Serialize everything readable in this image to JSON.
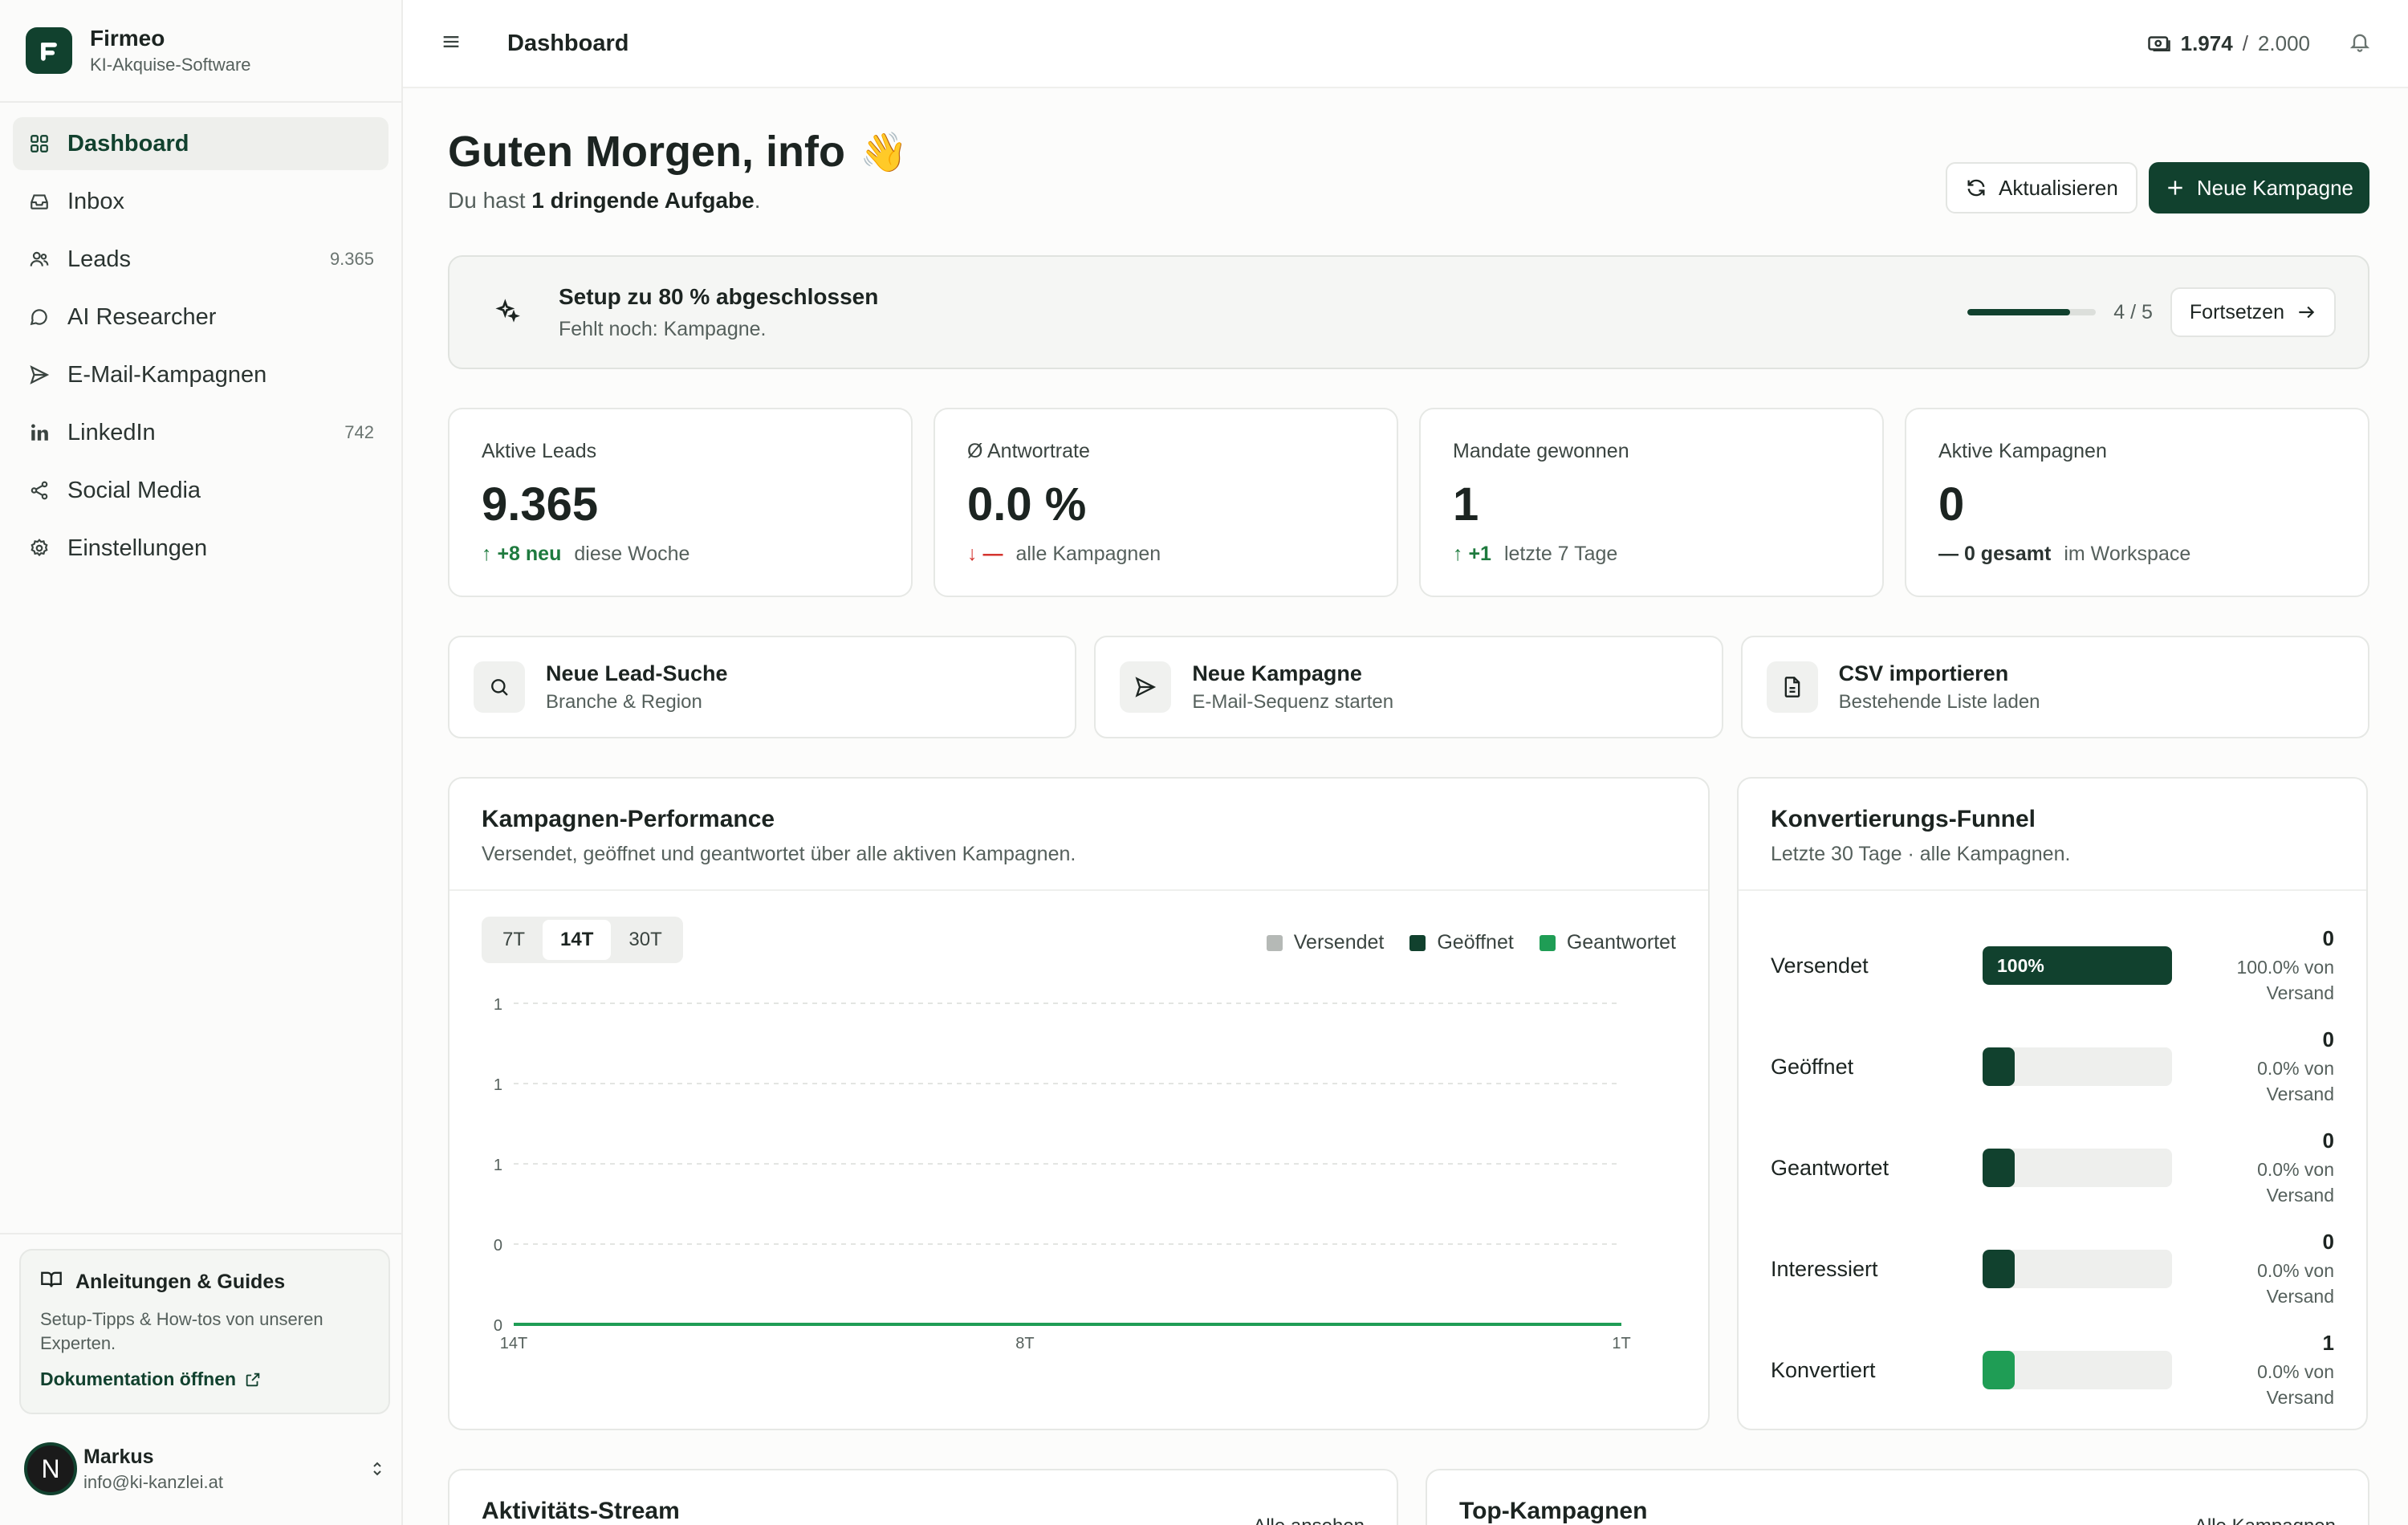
{
  "brand": {
    "name": "Firmeo",
    "subtitle": "KI-Akquise-Software"
  },
  "sidebar": {
    "items": [
      {
        "label": "Dashboard",
        "icon": "grid-icon",
        "count": ""
      },
      {
        "label": "Inbox",
        "icon": "inbox-icon",
        "count": ""
      },
      {
        "label": "Leads",
        "icon": "users-icon",
        "count": "9.365"
      },
      {
        "label": "AI Researcher",
        "icon": "chat-bubble-icon",
        "count": ""
      },
      {
        "label": "E-Mail-Kampagnen",
        "icon": "send-icon",
        "count": ""
      },
      {
        "label": "LinkedIn",
        "icon": "linkedin-icon",
        "count": "742"
      },
      {
        "label": "Social Media",
        "icon": "share-icon",
        "count": ""
      },
      {
        "label": "Einstellungen",
        "icon": "gear-icon",
        "count": ""
      }
    ],
    "guide": {
      "title": "Anleitungen & Guides",
      "description": "Setup-Tipps & How-tos von unseren Experten.",
      "link": "Dokumentation öffnen"
    },
    "user": {
      "initial": "N",
      "name": "Markus",
      "email": "info@ki-kanzlei.at"
    }
  },
  "topbar": {
    "title": "Dashboard",
    "credits_used": "1.974",
    "credits_sep": "/",
    "credits_total": "2.000"
  },
  "header": {
    "greeting": "Guten Morgen, info",
    "wave": "👋",
    "sub_prefix": "Du hast",
    "sub_bold": "1 dringende Aufgabe",
    "sub_suffix": ".",
    "refresh_label": "Aktualisieren",
    "new_campaign_label": "Neue Kampagne"
  },
  "setup": {
    "title": "Setup zu 80 % abgeschlossen",
    "subtitle": "Fehlt noch: Kampagne.",
    "progress": 0.8,
    "step": "4 / 5",
    "continue_label": "Fortsetzen"
  },
  "stats": [
    {
      "label": "Aktive Leads",
      "value": "9.365",
      "arrow": "↑",
      "delta": "+8 neu",
      "note": "diese Woche",
      "trend": "up"
    },
    {
      "label": "Ø Antwortrate",
      "value": "0.0 %",
      "arrow": "↓",
      "delta": "—",
      "note": "alle Kampagnen",
      "trend": "down"
    },
    {
      "label": "Mandate gewonnen",
      "value": "1",
      "arrow": "↑",
      "delta": "+1",
      "note": "letzte 7 Tage",
      "trend": "up"
    },
    {
      "label": "Aktive Kampagnen",
      "value": "0",
      "arrow": "—",
      "delta": "0 gesamt",
      "note": "im Workspace",
      "trend": "flat"
    }
  ],
  "quick_actions": [
    {
      "title": "Neue Lead-Suche",
      "subtitle": "Branche & Region",
      "icon": "search-icon"
    },
    {
      "title": "Neue Kampagne",
      "subtitle": "E-Mail-Sequenz starten",
      "icon": "send-icon"
    },
    {
      "title": "CSV importieren",
      "subtitle": "Bestehende Liste laden",
      "icon": "file-icon"
    }
  ],
  "performance": {
    "title": "Kampagnen-Performance",
    "subtitle": "Versendet, geöffnet und geantwortet über alle aktiven Kampagnen.",
    "ranges": [
      "7T",
      "14T",
      "30T"
    ],
    "active_range": "14T",
    "legend": [
      {
        "name": "Versendet",
        "color": "#b5b9b6"
      },
      {
        "name": "Geöffnet",
        "color": "#11412e"
      },
      {
        "name": "Geantwortet",
        "color": "#1f9d55"
      }
    ]
  },
  "chart_data": {
    "type": "line",
    "x": [
      "14T",
      "13T",
      "12T",
      "11T",
      "10T",
      "9T",
      "8T",
      "7T",
      "6T",
      "5T",
      "4T",
      "3T",
      "2T",
      "1T"
    ],
    "x_tick_labels": [
      "14T",
      "8T",
      "1T"
    ],
    "y_tick_labels": [
      "1",
      "1",
      "1",
      "0",
      "0"
    ],
    "ylim": [
      0,
      1
    ],
    "grid": true,
    "legend_position": "top-right",
    "series": [
      {
        "name": "Versendet",
        "color": "#b5b9b6",
        "values": [
          0,
          0,
          0,
          0,
          0,
          0,
          0,
          0,
          0,
          0,
          0,
          0,
          0,
          0
        ]
      },
      {
        "name": "Geöffnet",
        "color": "#11412e",
        "values": [
          0,
          0,
          0,
          0,
          0,
          0,
          0,
          0,
          0,
          0,
          0,
          0,
          0,
          0
        ]
      },
      {
        "name": "Geantwortet",
        "color": "#1f9d55",
        "values": [
          0,
          0,
          0,
          0,
          0,
          0,
          0,
          0,
          0,
          0,
          0,
          0,
          0,
          0
        ]
      }
    ]
  },
  "funnel": {
    "title": "Konvertierungs-Funnel",
    "subtitle": "Letzte 30 Tage · alle Kampagnen.",
    "rows": [
      {
        "label": "Versendet",
        "count": "0",
        "pct_line1": "100.0% von",
        "pct_line2": "Versand",
        "bar_label": "100%",
        "fill": 1.0,
        "color": "#11412e"
      },
      {
        "label": "Geöffnet",
        "count": "0",
        "pct_line1": "0.0% von",
        "pct_line2": "Versand",
        "bar_label": "",
        "fill": 0.0,
        "color": "#11412e"
      },
      {
        "label": "Geantwortet",
        "count": "0",
        "pct_line1": "0.0% von",
        "pct_line2": "Versand",
        "bar_label": "",
        "fill": 0.0,
        "color": "#11412e"
      },
      {
        "label": "Interessiert",
        "count": "0",
        "pct_line1": "0.0% von",
        "pct_line2": "Versand",
        "bar_label": "",
        "fill": 0.0,
        "color": "#11412e"
      },
      {
        "label": "Konvertiert",
        "count": "1",
        "pct_line1": "0.0% von",
        "pct_line2": "Versand",
        "bar_label": "",
        "fill": 0.0,
        "color": "#1f9d55"
      }
    ]
  },
  "bottom": {
    "activity_title": "Aktivitäts-Stream",
    "activity_link": "Alle ansehen",
    "top_title": "Top-Kampagnen",
    "top_link": "Alle Kampagnen"
  }
}
